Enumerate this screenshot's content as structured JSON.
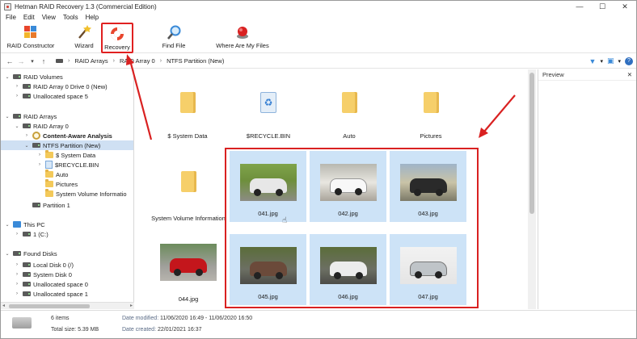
{
  "window": {
    "title": "Hetman RAID Recovery 1.3 (Commercial Edition)",
    "controls": {
      "minimize": "—",
      "maximize": "☐",
      "close": "✕"
    }
  },
  "menu": [
    "File",
    "Edit",
    "View",
    "Tools",
    "Help"
  ],
  "toolbar": {
    "raid_constructor": "RAID Constructor",
    "wizard": "Wizard",
    "recovery": "Recovery",
    "find_file": "Find File",
    "where_are_my_files": "Where Are My Files"
  },
  "breadcrumb": [
    "RAID Arrays",
    "RAID Array 0",
    "NTFS Partition (New)"
  ],
  "tree": {
    "raid_volumes": "RAID Volumes",
    "raid_array_drive": "RAID Array 0 Drive 0 (New)",
    "unallocated_5": "Unallocated space 5",
    "raid_arrays": "RAID Arrays",
    "raid_array_0": "RAID Array 0",
    "content_aware": "Content-Aware Analysis",
    "ntfs_partition": "NTFS Partition (New)",
    "system_data": "$ System Data",
    "recycle_bin": "$RECYCLE.BIN",
    "auto": "Auto",
    "pictures": "Pictures",
    "system_volume": "System Volume Informatio",
    "partition_1": "Partition 1",
    "this_pc": "This PC",
    "drive_c": "1 (C:)",
    "found_disks": "Found Disks",
    "local_disk_0": "Local Disk 0 (/)",
    "system_disk_0": "System Disk 0",
    "unallocated_0": "Unallocated space 0",
    "unallocated_1": "Unallocated space 1"
  },
  "folders": [
    "$ System Data",
    "$RECYCLE.BIN",
    "Auto",
    "Pictures",
    "System Volume Information"
  ],
  "files": [
    "041.jpg",
    "042.jpg",
    "043.jpg",
    "044.jpg",
    "045.jpg",
    "046.jpg",
    "047.jpg"
  ],
  "preview": {
    "title": "Preview",
    "close": "✕"
  },
  "status": {
    "items": "6 items",
    "total_size": "Total size: 5.39 MB",
    "date_modified_label": "Date modified:",
    "date_modified": "11/06/2020 16:49 - 11/06/2020 16:50",
    "date_created_label": "Date created:",
    "date_created": "22/01/2021 16:37"
  },
  "colors": {
    "highlight_red": "#d92121",
    "selection_blue": "#cde3f7",
    "tree_selected": "#cfe0f3"
  }
}
